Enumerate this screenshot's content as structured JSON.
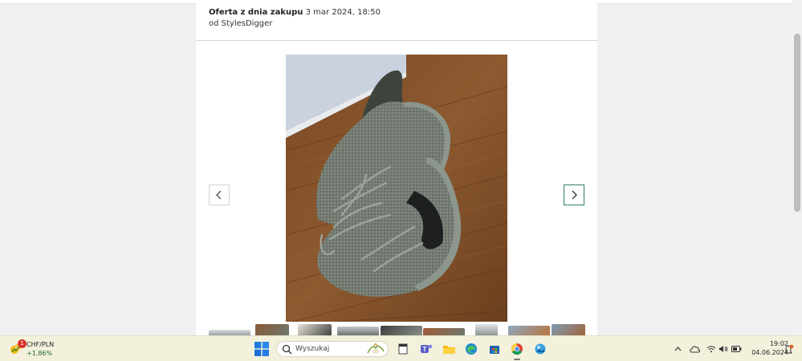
{
  "offer": {
    "label": "Oferta z dnia zakupu",
    "date": "3 mar 2024, 18:50",
    "seller": "od StylesDigger"
  },
  "gallery": {
    "prev_icon": "chevron-left-icon",
    "next_icon": "chevron-right-icon",
    "thumbnail_count": 9,
    "accent": "#2c7a6a"
  },
  "taskbar": {
    "widget": {
      "icon": "currency-widget-icon",
      "badge": "1",
      "title": "CHF/PLN",
      "value": "+1,86%",
      "value_color": "#1e6b2e"
    },
    "search": {
      "placeholder": "Wyszukaj"
    },
    "apps": [
      "file-explorer-icon",
      "teams-icon",
      "folder-icon",
      "edge-icon",
      "store-icon",
      "chrome-icon",
      "photos-icon"
    ],
    "tray_icons": [
      "chevron-up-icon",
      "cloud-icon",
      "wifi-icon",
      "volume-icon",
      "battery-icon"
    ],
    "time": "19:02",
    "date": "04.06.2024"
  }
}
